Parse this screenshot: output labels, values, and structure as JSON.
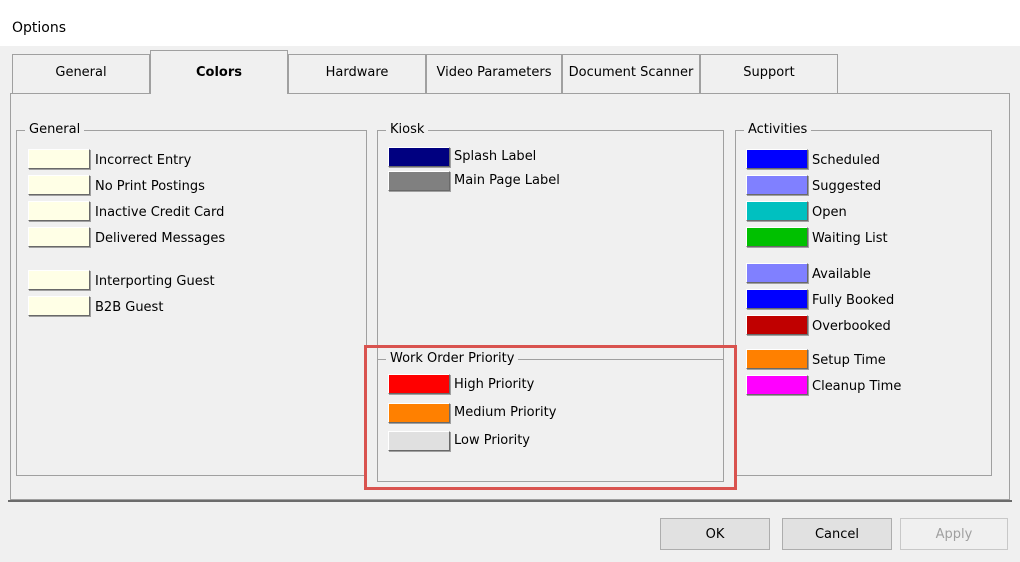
{
  "window": {
    "title": "Options"
  },
  "tabs": [
    {
      "label": "General"
    },
    {
      "label": "Colors"
    },
    {
      "label": "Hardware"
    },
    {
      "label": "Video Parameters"
    },
    {
      "label": "Document Scanner"
    },
    {
      "label": "Support"
    }
  ],
  "groups": {
    "general": {
      "title": "General",
      "items": [
        {
          "label": "Incorrect Entry",
          "color": "#ffffe6"
        },
        {
          "label": "No Print Postings",
          "color": "#ffffe6"
        },
        {
          "label": "Inactive Credit Card",
          "color": "#ffffe6"
        },
        {
          "label": "Delivered Messages",
          "color": "#ffffe6"
        },
        {
          "label": "Interporting Guest",
          "color": "#ffffe6"
        },
        {
          "label": "B2B Guest",
          "color": "#ffffe6"
        }
      ]
    },
    "kiosk": {
      "title": "Kiosk",
      "items": [
        {
          "label": "Splash Label",
          "color": "#000080"
        },
        {
          "label": "Main Page Label",
          "color": "#808080"
        }
      ]
    },
    "work_order": {
      "title": "Work Order Priority",
      "items": [
        {
          "label": "High Priority",
          "color": "#ff0000"
        },
        {
          "label": "Medium Priority",
          "color": "#ff8000"
        },
        {
          "label": "Low Priority",
          "color": "#e0e0e0"
        }
      ]
    },
    "activities": {
      "title": "Activities",
      "items": [
        {
          "label": "Scheduled",
          "color": "#0000ff"
        },
        {
          "label": "Suggested",
          "color": "#8080ff"
        },
        {
          "label": "Open",
          "color": "#00c0c0"
        },
        {
          "label": "Waiting List",
          "color": "#00c000"
        },
        {
          "label": "Available",
          "color": "#8080ff"
        },
        {
          "label": "Fully Booked",
          "color": "#0000ff"
        },
        {
          "label": "Overbooked",
          "color": "#c00000"
        },
        {
          "label": "Setup Time",
          "color": "#ff8000"
        },
        {
          "label": "Cleanup Time",
          "color": "#ff00ff"
        }
      ]
    }
  },
  "buttons": {
    "ok": "OK",
    "cancel": "Cancel",
    "apply": "Apply"
  }
}
